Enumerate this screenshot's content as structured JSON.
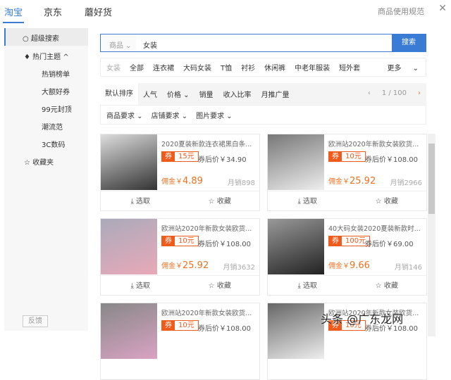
{
  "tabs": [
    "淘宝",
    "京东",
    "蘑好货"
  ],
  "rules": "商品使用规范",
  "close": "✕",
  "sidebar": {
    "search": "超级搜索",
    "hot": "热门主题",
    "items": [
      "热销榜单",
      "大额好券",
      "99元封顶",
      "潮流范",
      "3C数码"
    ],
    "fav": "收藏夹",
    "feedback": "反馈"
  },
  "search": {
    "select": "商品",
    "query": "女装",
    "button": "搜索"
  },
  "cats": {
    "label": "女装",
    "items": [
      "全部",
      "连衣裙",
      "大码女装",
      "T恤",
      "衬衫",
      "休闲裤",
      "中老年服装",
      "短外套"
    ],
    "more": "更多"
  },
  "sort": {
    "items": [
      "默认排序",
      "人气",
      "价格",
      "销量",
      "收入比率",
      "月推广量"
    ],
    "page": "1 / 100"
  },
  "filters": [
    "商品要求",
    "店铺要求",
    "图片要求"
  ],
  "actions": {
    "pick": "选取",
    "fav": "收藏"
  },
  "coupon_tag": "券",
  "products": [
    {
      "title": "2020夏装新款连衣裙黑白条...",
      "coupon": "15元",
      "after": "券后价￥34.90",
      "comm_prefix": "佣金￥",
      "comm": "4.89",
      "sales": "月销898"
    },
    {
      "title": "欧洲站2020年新款女装欧货...",
      "coupon": "10元",
      "after": "券后价￥108.00",
      "comm_prefix": "佣金￥",
      "comm": "25.92",
      "sales": "月销2966"
    },
    {
      "title": "欧洲站2020年新款女装欧货...",
      "coupon": "10元",
      "after": "券后价￥108.00",
      "comm_prefix": "佣金￥",
      "comm": "25.92",
      "sales": "月销3632"
    },
    {
      "title": "40大码女装2020夏装新款时...",
      "coupon": "100元",
      "after": "券后价￥69.00",
      "comm_prefix": "佣金￥",
      "comm": "9.66",
      "sales": "月销146"
    },
    {
      "title": "欧洲站2020年新款女装欧货...",
      "coupon": "10元",
      "after": "券后价￥108.00"
    },
    {
      "title": "欧洲站2020年新款女装欧货...",
      "coupon": "10元",
      "after": "券后价￥108.00"
    }
  ],
  "watermark": "头条 @广东龙网"
}
